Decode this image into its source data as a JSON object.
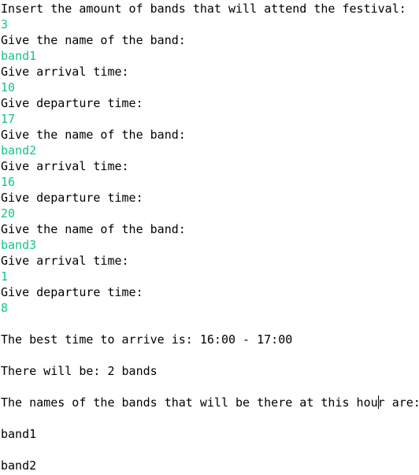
{
  "console": {
    "lines": [
      {
        "text": "Insert the amount of bands that will attend the festival:",
        "kind": "output"
      },
      {
        "text": "3",
        "kind": "input"
      },
      {
        "text": "Give the name of the band:",
        "kind": "output"
      },
      {
        "text": "band1",
        "kind": "input"
      },
      {
        "text": "Give arrival time:",
        "kind": "output"
      },
      {
        "text": "10",
        "kind": "input"
      },
      {
        "text": "Give departure time:",
        "kind": "output"
      },
      {
        "text": "17",
        "kind": "input"
      },
      {
        "text": "Give the name of the band:",
        "kind": "output"
      },
      {
        "text": "band2",
        "kind": "input"
      },
      {
        "text": "Give arrival time:",
        "kind": "output"
      },
      {
        "text": "16",
        "kind": "input"
      },
      {
        "text": "Give departure time:",
        "kind": "output"
      },
      {
        "text": "20",
        "kind": "input"
      },
      {
        "text": "Give the name of the band:",
        "kind": "output"
      },
      {
        "text": "band3",
        "kind": "input"
      },
      {
        "text": "Give arrival time:",
        "kind": "output"
      },
      {
        "text": "1",
        "kind": "input"
      },
      {
        "text": "Give departure time:",
        "kind": "output"
      },
      {
        "text": "8",
        "kind": "input"
      },
      {
        "text": "",
        "kind": "blank"
      },
      {
        "text": "The best time to arrive is: 16:00 - 17:00",
        "kind": "output"
      },
      {
        "text": "",
        "kind": "blank"
      },
      {
        "text": "There will be: 2 bands",
        "kind": "output"
      },
      {
        "text": "",
        "kind": "blank"
      },
      {
        "text": "The names of the bands that will be there at this hour are:",
        "kind": "output"
      },
      {
        "text": "",
        "kind": "blank"
      },
      {
        "text": "band1",
        "kind": "output"
      },
      {
        "text": "",
        "kind": "blank"
      },
      {
        "text": "band2",
        "kind": "output"
      }
    ],
    "colors": {
      "output": "#000000",
      "input": "#19c28a",
      "background": "#ffffff"
    }
  }
}
